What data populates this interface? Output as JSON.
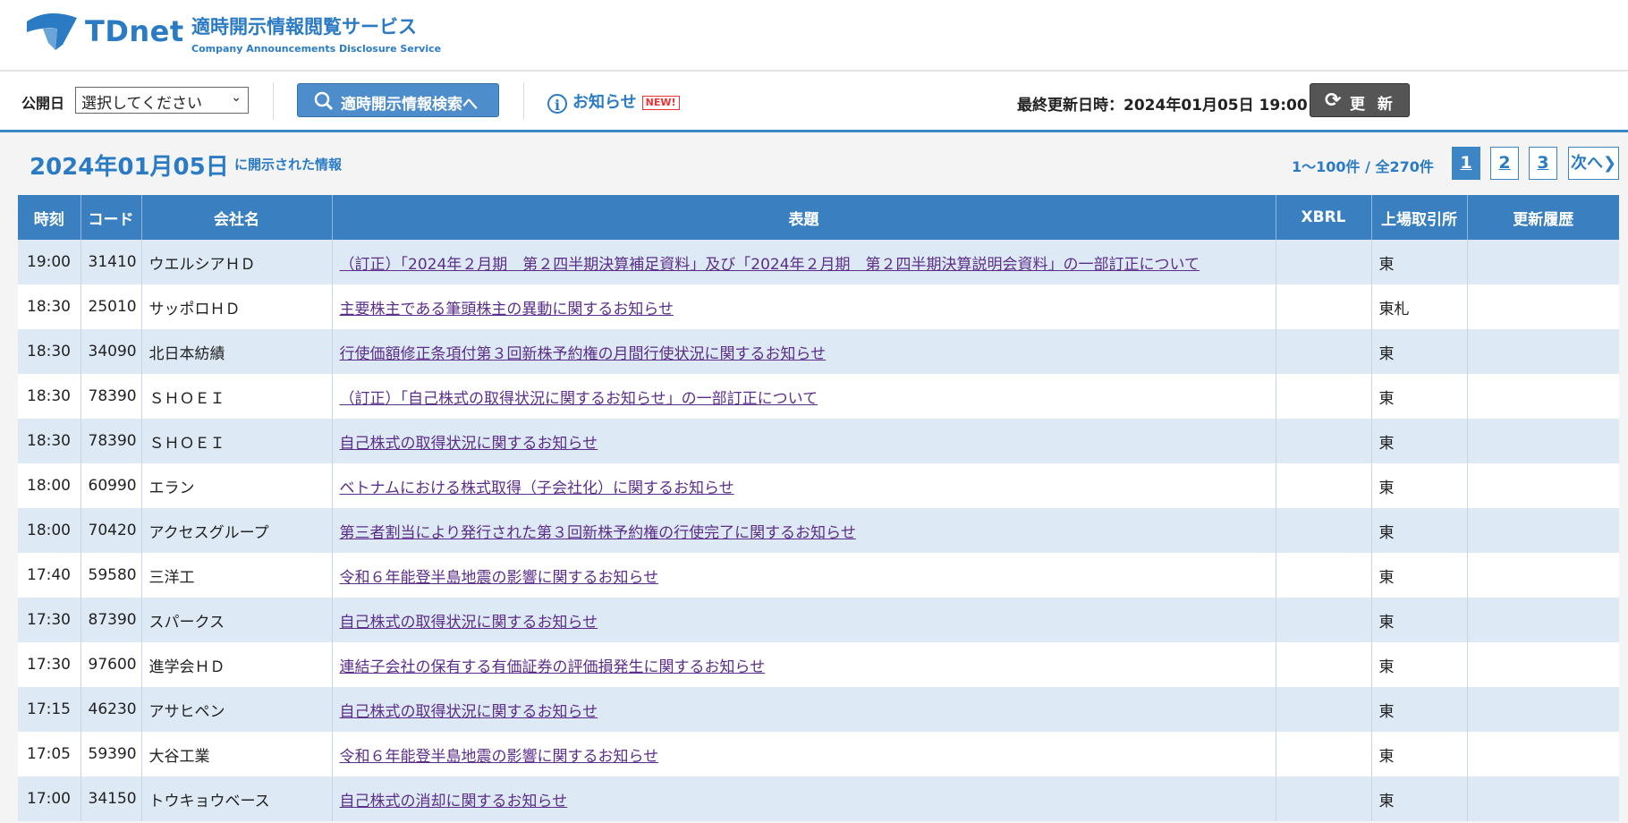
{
  "header": {
    "logo_text": "TDnet",
    "service_title": "適時開示情報閲覧サービス",
    "service_sub": "Company Announcements Disclosure Service"
  },
  "toolbar": {
    "pub_label": "公開日",
    "pub_select_value": "選択してください",
    "search_button": "適時開示情報検索へ",
    "notice_label": "お知らせ",
    "notice_badge": "NEW!",
    "last_updated": "最終更新日時：2024年01月05日 19:00",
    "refresh_button": "更 新"
  },
  "summary": {
    "date": "2024年01月05日",
    "date_sub": "に開示された情報",
    "count": "1～100件 / 全270件",
    "pages": [
      "1",
      "2",
      "3"
    ],
    "next": "次へ"
  },
  "table": {
    "headers": [
      "時刻",
      "コード",
      "会社名",
      "表題",
      "XBRL",
      "上場取引所",
      "更新履歴"
    ],
    "rows": [
      {
        "time": "19:00",
        "code": "31410",
        "company": "ウエルシアＨＤ",
        "title": "（訂正）「2024年２月期　第２四半期決算補足資料」及び「2024年２月期　第２四半期決算説明会資料」の一部訂正について",
        "xbrl": "",
        "exchange": "東",
        "history": ""
      },
      {
        "time": "18:30",
        "code": "25010",
        "company": "サッポロＨＤ",
        "title": "主要株主である筆頭株主の異動に関するお知らせ",
        "xbrl": "",
        "exchange": "東札",
        "history": ""
      },
      {
        "time": "18:30",
        "code": "34090",
        "company": "北日本紡績",
        "title": "行使価額修正条項付第３回新株予約権の月間行使状況に関するお知らせ",
        "xbrl": "",
        "exchange": "東",
        "history": ""
      },
      {
        "time": "18:30",
        "code": "78390",
        "company": "ＳＨＯＥＩ",
        "title": "（訂正）「自己株式の取得状況に関するお知らせ」の一部訂正について",
        "xbrl": "",
        "exchange": "東",
        "history": ""
      },
      {
        "time": "18:30",
        "code": "78390",
        "company": "ＳＨＯＥＩ",
        "title": "自己株式の取得状況に関するお知らせ",
        "xbrl": "",
        "exchange": "東",
        "history": ""
      },
      {
        "time": "18:00",
        "code": "60990",
        "company": "エラン",
        "title": "ベトナムにおける株式取得（子会社化）に関するお知らせ",
        "xbrl": "",
        "exchange": "東",
        "history": ""
      },
      {
        "time": "18:00",
        "code": "70420",
        "company": "アクセスグループ",
        "title": "第三者割当により発行された第３回新株予約権の行使完了に関するお知らせ",
        "xbrl": "",
        "exchange": "東",
        "history": ""
      },
      {
        "time": "17:40",
        "code": "59580",
        "company": "三洋工",
        "title": "令和６年能登半島地震の影響に関するお知らせ",
        "xbrl": "",
        "exchange": "東",
        "history": ""
      },
      {
        "time": "17:30",
        "code": "87390",
        "company": "スパークス",
        "title": "自己株式の取得状況に関するお知らせ",
        "xbrl": "",
        "exchange": "東",
        "history": ""
      },
      {
        "time": "17:30",
        "code": "97600",
        "company": "進学会ＨＤ",
        "title": "連結子会社の保有する有価証券の評価損発生に関するお知らせ",
        "xbrl": "",
        "exchange": "東",
        "history": ""
      },
      {
        "time": "17:15",
        "code": "46230",
        "company": "アサヒペン",
        "title": "自己株式の取得状況に関するお知らせ",
        "xbrl": "",
        "exchange": "東",
        "history": ""
      },
      {
        "time": "17:05",
        "code": "59390",
        "company": "大谷工業",
        "title": "令和６年能登半島地震の影響に関するお知らせ",
        "xbrl": "",
        "exchange": "東",
        "history": ""
      },
      {
        "time": "17:00",
        "code": "34150",
        "company": "トウキョウベース",
        "title": "自己株式の消却に関するお知らせ",
        "xbrl": "",
        "exchange": "東",
        "history": ""
      }
    ]
  }
}
